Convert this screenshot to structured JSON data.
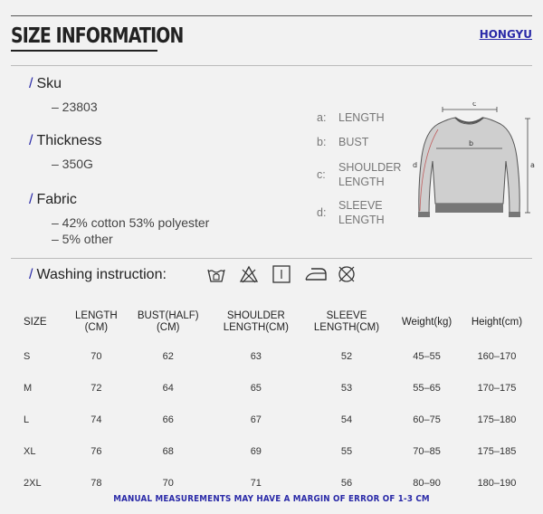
{
  "header": {
    "title": "SIZE INFORMATION",
    "brand": "HONGYU"
  },
  "specs": {
    "sku": {
      "label": "Sku",
      "value": "– 23803"
    },
    "thickness": {
      "label": "Thickness",
      "value": "– 350G"
    },
    "fabric": {
      "label": "Fabric",
      "lines": [
        "– 42% cotton 53% polyester",
        "– 5% other"
      ]
    }
  },
  "legend": [
    {
      "key": "a:",
      "lines": [
        "LENGTH"
      ]
    },
    {
      "key": "b:",
      "lines": [
        "BUST"
      ]
    },
    {
      "key": "c:",
      "lines": [
        "SHOULDER",
        "LENGTH"
      ]
    },
    {
      "key": "d:",
      "lines": [
        "SLEEVE",
        "LENGTH"
      ]
    }
  ],
  "diagram_labels": {
    "a": "a",
    "b": "b",
    "c": "c",
    "d": "d"
  },
  "washing": {
    "label": "Washing instruction:",
    "icons": [
      "hand-wash-icon",
      "no-bleach-icon",
      "line-dry-icon",
      "iron-icon",
      "no-dry-clean-icon"
    ]
  },
  "table": {
    "headers": [
      [
        "SIZE"
      ],
      [
        "LENGTH",
        "(CM)"
      ],
      [
        "BUST(HALF)",
        "(CM)"
      ],
      [
        "SHOULDER",
        "LENGTH(CM)"
      ],
      [
        "SLEEVE",
        "LENGTH(CM)"
      ],
      [
        "Weight(kg)"
      ],
      [
        "Height(cm)"
      ]
    ],
    "rows": [
      [
        "S",
        "70",
        "62",
        "63",
        "52",
        "45–55",
        "160–170"
      ],
      [
        "M",
        "72",
        "64",
        "65",
        "53",
        "55–65",
        "170–175"
      ],
      [
        "L",
        "74",
        "66",
        "67",
        "54",
        "60–75",
        "175–180"
      ],
      [
        "XL",
        "76",
        "68",
        "69",
        "55",
        "70–85",
        "175–185"
      ],
      [
        "2XL",
        "78",
        "70",
        "71",
        "56",
        "80–90",
        "180–190"
      ]
    ]
  },
  "footer": "MANUAL MEASUREMENTS MAY HAVE A MARGIN OF ERROR OF 1-3 CM",
  "colors": {
    "accent": "#2a2aa8",
    "background": "#f2f2f2",
    "text": "#333333"
  }
}
